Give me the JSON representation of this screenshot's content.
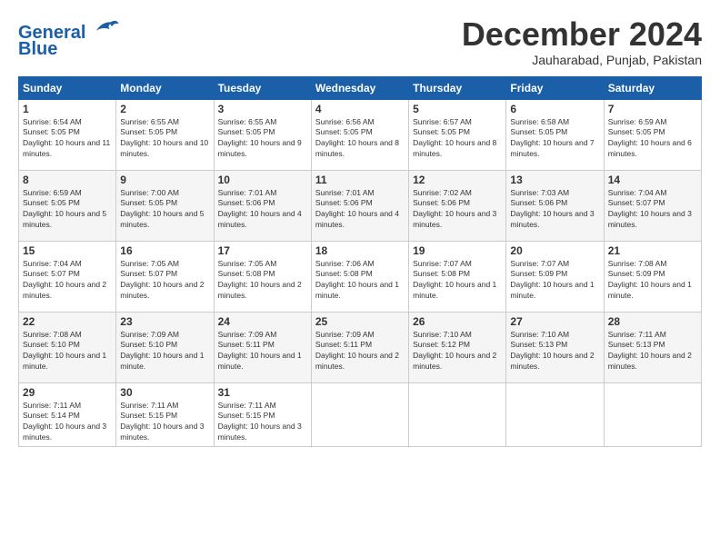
{
  "header": {
    "logo_line1": "General",
    "logo_line2": "Blue",
    "month": "December 2024",
    "location": "Jauharabad, Punjab, Pakistan"
  },
  "days_of_week": [
    "Sunday",
    "Monday",
    "Tuesday",
    "Wednesday",
    "Thursday",
    "Friday",
    "Saturday"
  ],
  "weeks": [
    [
      {
        "day": 1,
        "sunrise": "6:54 AM",
        "sunset": "5:05 PM",
        "daylight": "10 hours and 11 minutes."
      },
      {
        "day": 2,
        "sunrise": "6:55 AM",
        "sunset": "5:05 PM",
        "daylight": "10 hours and 10 minutes."
      },
      {
        "day": 3,
        "sunrise": "6:55 AM",
        "sunset": "5:05 PM",
        "daylight": "10 hours and 9 minutes."
      },
      {
        "day": 4,
        "sunrise": "6:56 AM",
        "sunset": "5:05 PM",
        "daylight": "10 hours and 8 minutes."
      },
      {
        "day": 5,
        "sunrise": "6:57 AM",
        "sunset": "5:05 PM",
        "daylight": "10 hours and 8 minutes."
      },
      {
        "day": 6,
        "sunrise": "6:58 AM",
        "sunset": "5:05 PM",
        "daylight": "10 hours and 7 minutes."
      },
      {
        "day": 7,
        "sunrise": "6:59 AM",
        "sunset": "5:05 PM",
        "daylight": "10 hours and 6 minutes."
      }
    ],
    [
      {
        "day": 8,
        "sunrise": "6:59 AM",
        "sunset": "5:05 PM",
        "daylight": "10 hours and 5 minutes."
      },
      {
        "day": 9,
        "sunrise": "7:00 AM",
        "sunset": "5:05 PM",
        "daylight": "10 hours and 5 minutes."
      },
      {
        "day": 10,
        "sunrise": "7:01 AM",
        "sunset": "5:06 PM",
        "daylight": "10 hours and 4 minutes."
      },
      {
        "day": 11,
        "sunrise": "7:01 AM",
        "sunset": "5:06 PM",
        "daylight": "10 hours and 4 minutes."
      },
      {
        "day": 12,
        "sunrise": "7:02 AM",
        "sunset": "5:06 PM",
        "daylight": "10 hours and 3 minutes."
      },
      {
        "day": 13,
        "sunrise": "7:03 AM",
        "sunset": "5:06 PM",
        "daylight": "10 hours and 3 minutes."
      },
      {
        "day": 14,
        "sunrise": "7:04 AM",
        "sunset": "5:07 PM",
        "daylight": "10 hours and 3 minutes."
      }
    ],
    [
      {
        "day": 15,
        "sunrise": "7:04 AM",
        "sunset": "5:07 PM",
        "daylight": "10 hours and 2 minutes."
      },
      {
        "day": 16,
        "sunrise": "7:05 AM",
        "sunset": "5:07 PM",
        "daylight": "10 hours and 2 minutes."
      },
      {
        "day": 17,
        "sunrise": "7:05 AM",
        "sunset": "5:08 PM",
        "daylight": "10 hours and 2 minutes."
      },
      {
        "day": 18,
        "sunrise": "7:06 AM",
        "sunset": "5:08 PM",
        "daylight": "10 hours and 1 minute."
      },
      {
        "day": 19,
        "sunrise": "7:07 AM",
        "sunset": "5:08 PM",
        "daylight": "10 hours and 1 minute."
      },
      {
        "day": 20,
        "sunrise": "7:07 AM",
        "sunset": "5:09 PM",
        "daylight": "10 hours and 1 minute."
      },
      {
        "day": 21,
        "sunrise": "7:08 AM",
        "sunset": "5:09 PM",
        "daylight": "10 hours and 1 minute."
      }
    ],
    [
      {
        "day": 22,
        "sunrise": "7:08 AM",
        "sunset": "5:10 PM",
        "daylight": "10 hours and 1 minute."
      },
      {
        "day": 23,
        "sunrise": "7:09 AM",
        "sunset": "5:10 PM",
        "daylight": "10 hours and 1 minute."
      },
      {
        "day": 24,
        "sunrise": "7:09 AM",
        "sunset": "5:11 PM",
        "daylight": "10 hours and 1 minute."
      },
      {
        "day": 25,
        "sunrise": "7:09 AM",
        "sunset": "5:11 PM",
        "daylight": "10 hours and 2 minutes."
      },
      {
        "day": 26,
        "sunrise": "7:10 AM",
        "sunset": "5:12 PM",
        "daylight": "10 hours and 2 minutes."
      },
      {
        "day": 27,
        "sunrise": "7:10 AM",
        "sunset": "5:13 PM",
        "daylight": "10 hours and 2 minutes."
      },
      {
        "day": 28,
        "sunrise": "7:11 AM",
        "sunset": "5:13 PM",
        "daylight": "10 hours and 2 minutes."
      }
    ],
    [
      {
        "day": 29,
        "sunrise": "7:11 AM",
        "sunset": "5:14 PM",
        "daylight": "10 hours and 3 minutes."
      },
      {
        "day": 30,
        "sunrise": "7:11 AM",
        "sunset": "5:15 PM",
        "daylight": "10 hours and 3 minutes."
      },
      {
        "day": 31,
        "sunrise": "7:11 AM",
        "sunset": "5:15 PM",
        "daylight": "10 hours and 3 minutes."
      },
      null,
      null,
      null,
      null
    ]
  ]
}
